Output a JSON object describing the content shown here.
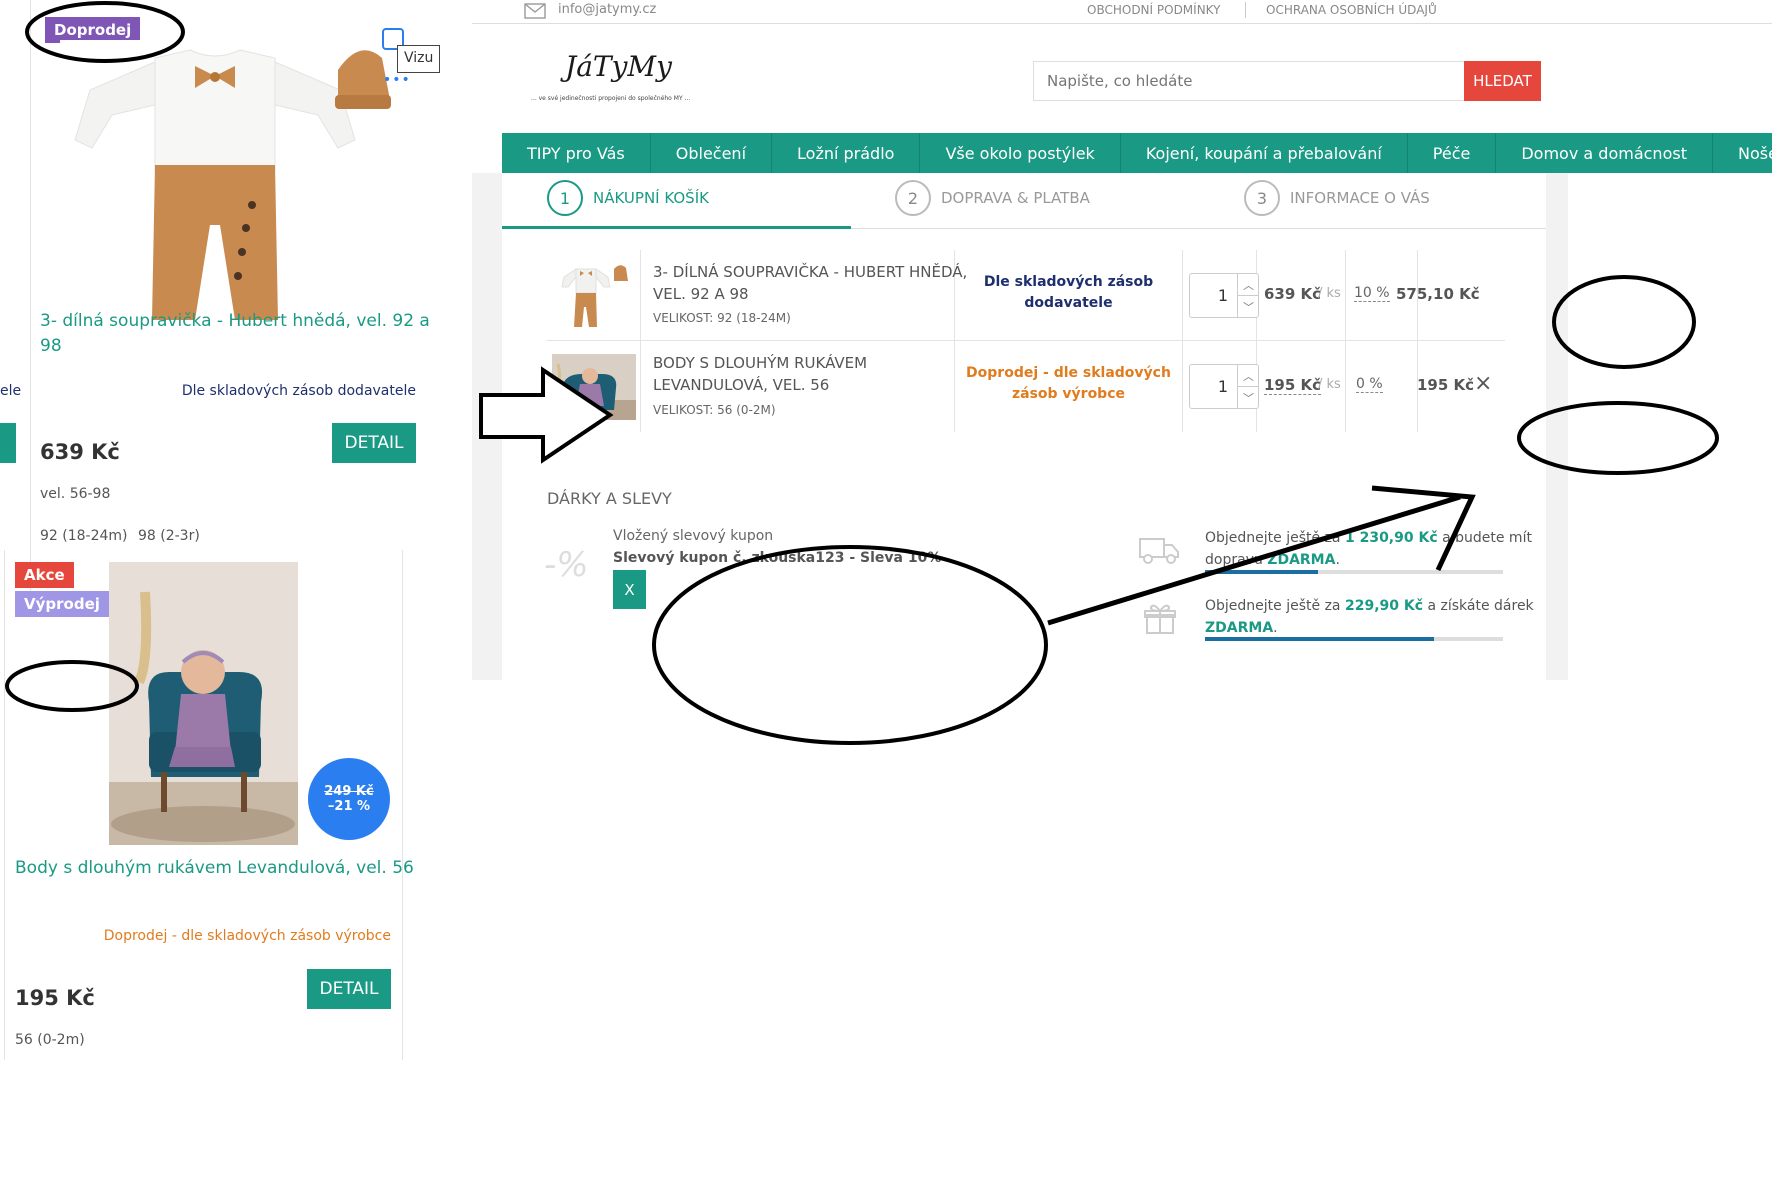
{
  "left_product_1": {
    "badge": "Doprodej",
    "visualize_label": "Vizu",
    "name_line1": "3- dílná soupravička - Hubert hnědá, vel. 92 a",
    "name_line2": "98",
    "availability": "Dle skladových zásob dodavatele",
    "side_fragment": "ele",
    "price": "639 Kč",
    "detail_button": "DETAIL",
    "size_range": "vel. 56-98",
    "sizes": [
      "92 (18-24m)",
      "98 (2-3r)"
    ]
  },
  "left_product_2": {
    "badge_sale": "Akce",
    "badge_clearance": "Výprodej",
    "old_price": "249 Kč",
    "discount": "–21 %",
    "name": "Body s dlouhým rukávem Levandulová, vel. 56",
    "availability": "Doprodej - dle skladových zásob výrobce",
    "price": "195 Kč",
    "detail_button": "DETAIL",
    "sizes": [
      "56 (0-2m)"
    ]
  },
  "topbar": {
    "email": "info@jatymy.cz",
    "link_terms": "OBCHODNÍ PODMÍNKY",
    "link_privacy": "OCHRANA OSOBNÍCH ÚDAJŮ"
  },
  "header": {
    "logo": "JáTyMy",
    "tagline": "... ve své jedinečnosti propojeni do společného MY ...",
    "search_placeholder": "Napište, co hledáte",
    "search_button": "HLEDAT"
  },
  "nav": {
    "items": [
      "TIPY pro Vás",
      "Oblečení",
      "Ložní prádlo",
      "Vše okolo postýlek",
      "Kojení, koupání a přebalování",
      "Péče",
      "Domov a domácnost",
      "Nošení"
    ]
  },
  "steps": [
    {
      "num": "1",
      "label": "NÁKUPNÍ KOŠÍK"
    },
    {
      "num": "2",
      "label": "DOPRAVA & PLATBA"
    },
    {
      "num": "3",
      "label": "INFORMACE O VÁS"
    }
  ],
  "cart": {
    "items": [
      {
        "name_line1": "3- DÍLNÁ SOUPRAVIČKA - HUBERT HNĚDÁ,",
        "name_line2": "VEL. 92 A 98",
        "variant": "VELIKOST: 92 (18-24M)",
        "availability_line1": "Dle skladových zásob",
        "availability_line2": "dodavatele",
        "qty": "1",
        "unit_price": "639 Kč",
        "per_unit": "/ ks",
        "discount": "10 %",
        "total": "575,10 Kč"
      },
      {
        "name_line1": "BODY S DLOUHÝM RUKÁVEM",
        "name_line2": "LEVANDULOVÁ, VEL. 56",
        "variant": "VELIKOST: 56 (0-2M)",
        "availability_line1": "Doprodej - dle skladových",
        "availability_line2": "zásob výrobce",
        "qty": "1",
        "unit_price": "195 Kč",
        "per_unit": "/ ks",
        "discount": "0 %",
        "total": "195 Kč",
        "remove": "×"
      }
    ]
  },
  "gifts": {
    "heading": "DÁRKY A SLEVY",
    "percent_icon": "-%",
    "coupon_label": "Vložený slevový kupon",
    "coupon_value": "Slevový kupon č. zkouška123 - Sleva 10%",
    "coupon_remove": "X",
    "shipping_pre": "Objednejte ještě za",
    "shipping_amount": "1 230,90 Kč",
    "shipping_mid": "a budete mít",
    "shipping_line2": "dopravu",
    "shipping_free": "ZDARMA",
    "shipping_end": ".",
    "shipping_progress": 0.38,
    "gift_pre": "Objednejte ještě za",
    "gift_amount": "229,90 Kč",
    "gift_mid": "a získáte dárek",
    "gift_free": "ZDARMA",
    "gift_end": ".",
    "gift_progress": 0.77
  },
  "colors": {
    "teal": "#1a9a84",
    "red": "#e6473c",
    "purple": "#7f56b5",
    "lavender": "#9f96e6",
    "blue_badge": "#2a7ef0",
    "navy": "#1e2f6e",
    "orange": "#e07c1e"
  }
}
